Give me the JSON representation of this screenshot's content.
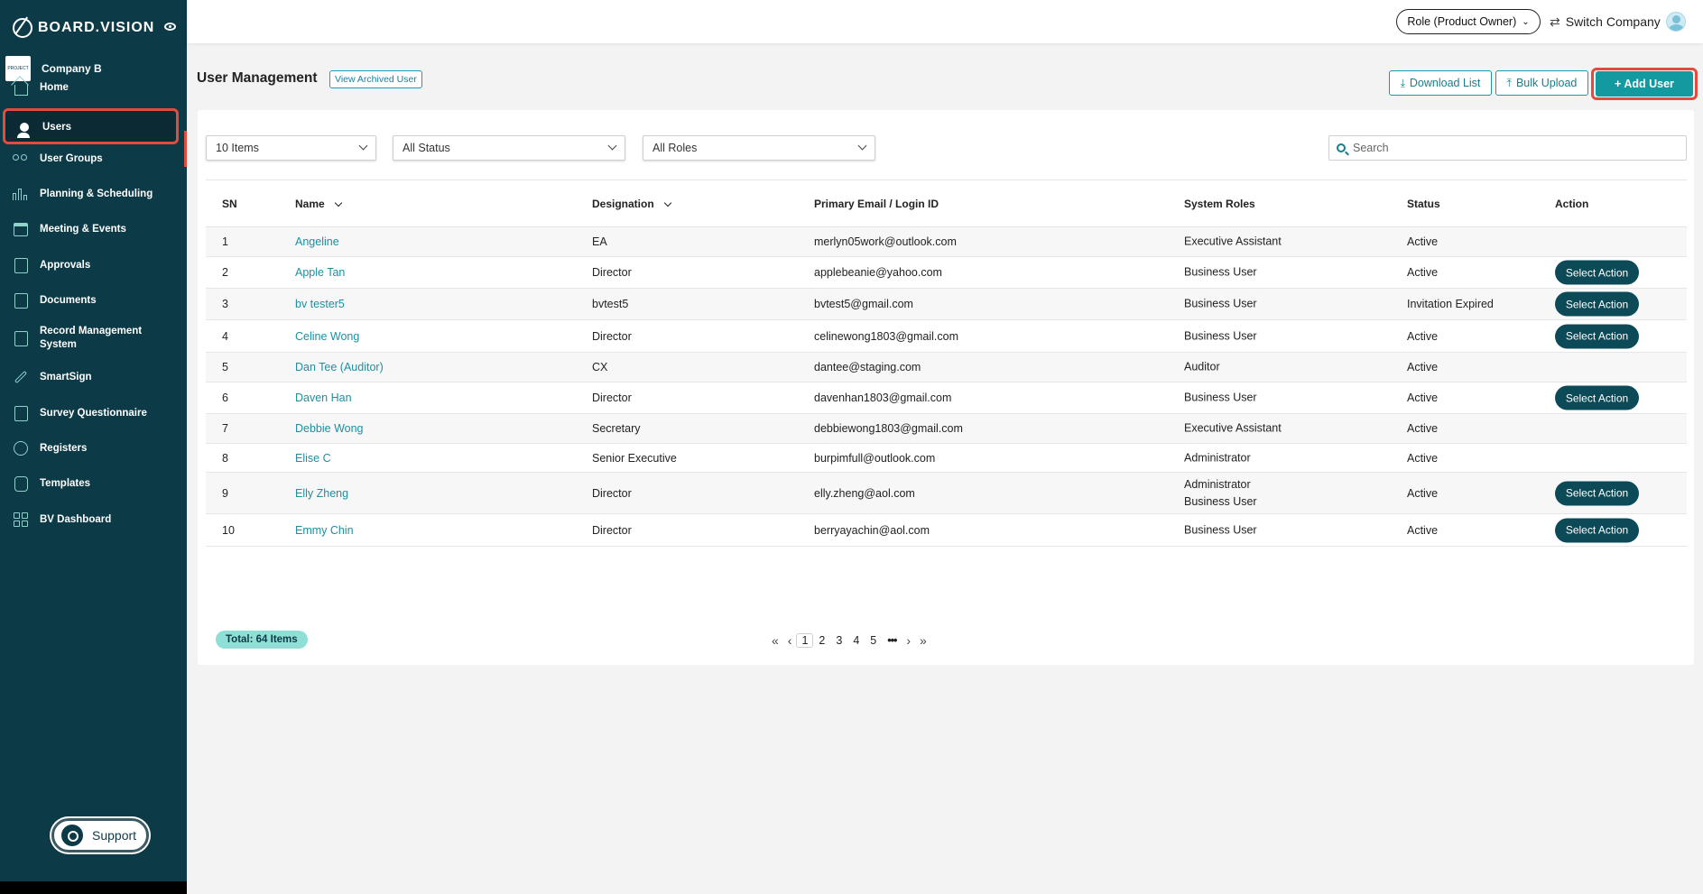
{
  "app": {
    "brand": "BOARD.VISION"
  },
  "company": {
    "name": "Company B",
    "logo_text": "PROJECT"
  },
  "sidebar": {
    "items": [
      {
        "label": "Home",
        "icon": "home-icon"
      },
      {
        "label": "Users",
        "icon": "user-icon",
        "active": true
      },
      {
        "label": "User Groups",
        "icon": "user-groups-icon"
      },
      {
        "label": "Planning & Scheduling",
        "icon": "bar-chart-icon"
      },
      {
        "label": "Meeting & Events",
        "icon": "calendar-icon"
      },
      {
        "label": "Approvals",
        "icon": "approvals-icon"
      },
      {
        "label": "Documents",
        "icon": "documents-icon"
      },
      {
        "label": "Record Management System",
        "icon": "record-management-icon"
      },
      {
        "label": "SmartSign",
        "icon": "pen-icon"
      },
      {
        "label": "Survey Questionnaire",
        "icon": "survey-icon"
      },
      {
        "label": "Registers",
        "icon": "registers-icon"
      },
      {
        "label": "Templates",
        "icon": "templates-icon"
      },
      {
        "label": "BV Dashboard",
        "icon": "dashboard-icon"
      }
    ],
    "support_label": "Support"
  },
  "topbar": {
    "role": "Role (Product Owner)",
    "switch_company": "Switch Company"
  },
  "page": {
    "title": "User Management",
    "archived_label": "View Archived User",
    "download_label": "Download List",
    "bulk_upload_label": "Bulk Upload",
    "add_user_label": "+ Add User"
  },
  "filters": {
    "items_per_page": "10 Items",
    "status": "All Status",
    "roles": "All Roles",
    "search_placeholder": "Search"
  },
  "table": {
    "headers": {
      "sn": "SN",
      "name": "Name",
      "designation": "Designation",
      "email": "Primary Email / Login ID",
      "roles": "System Roles",
      "status": "Status",
      "action": "Action"
    },
    "action_label": "Select Action",
    "rows": [
      {
        "sn": "1",
        "name": "Angeline",
        "designation": "EA",
        "email": "merlyn05work@outlook.com",
        "roles": "Executive Assistant",
        "status": "Active",
        "action": false
      },
      {
        "sn": "2",
        "name": "Apple Tan",
        "designation": "Director",
        "email": "applebeanie@yahoo.com",
        "roles": "Business User",
        "status": "Active",
        "action": true
      },
      {
        "sn": "3",
        "name": "bv tester5",
        "designation": "bvtest5",
        "email": "bvtest5@gmail.com",
        "roles": "Business User",
        "status": "Invitation Expired",
        "action": true
      },
      {
        "sn": "4",
        "name": "Celine Wong",
        "designation": "Director",
        "email": "celinewong1803@gmail.com",
        "roles": "Business User",
        "status": "Active",
        "action": true
      },
      {
        "sn": "5",
        "name": "Dan Tee (Auditor)",
        "designation": "CX",
        "email": "dantee@staging.com",
        "roles": "Auditor",
        "status": "Active",
        "action": false
      },
      {
        "sn": "6",
        "name": "Daven Han",
        "designation": "Director",
        "email": "davenhan1803@gmail.com",
        "roles": "Business User",
        "status": "Active",
        "action": true
      },
      {
        "sn": "7",
        "name": "Debbie Wong",
        "designation": "Secretary",
        "email": "debbiewong1803@gmail.com",
        "roles": "Executive Assistant",
        "status": "Active",
        "action": false
      },
      {
        "sn": "8",
        "name": "Elise C",
        "designation": "Senior Executive",
        "email": "burpimfull@outlook.com",
        "roles": "Administrator",
        "status": "Active",
        "action": false
      },
      {
        "sn": "9",
        "name": "Elly Zheng",
        "designation": "Director",
        "email": "elly.zheng@aol.com",
        "roles": "Administrator\nBusiness User",
        "status": "Active",
        "action": true
      },
      {
        "sn": "10",
        "name": "Emmy Chin",
        "designation": "Director",
        "email": "berryayachin@aol.com",
        "roles": "Business User",
        "status": "Active",
        "action": true
      }
    ]
  },
  "footer": {
    "total": "Total: 64 Items",
    "pages": [
      "1",
      "2",
      "3",
      "4",
      "5"
    ],
    "current_page": "1",
    "ellipsis": "•••",
    "first": "«",
    "prev": "‹",
    "next": "›",
    "last": "»"
  }
}
